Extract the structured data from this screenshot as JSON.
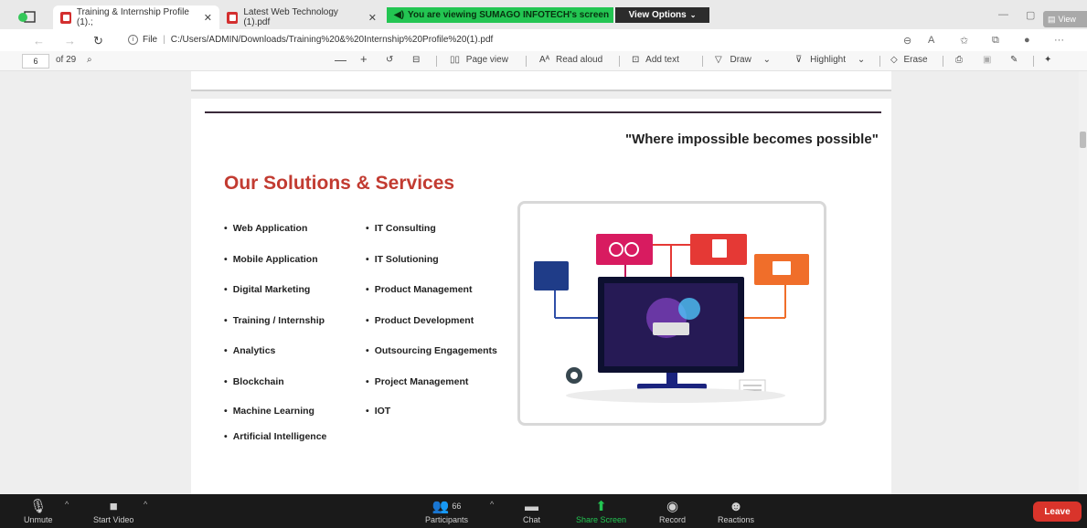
{
  "tabs": [
    {
      "title": "Training & Internship Profile (1).;",
      "active": true
    },
    {
      "title": "Latest Web Technology (1).pdf",
      "active": false
    }
  ],
  "share_banner": "You are viewing SUMAGO INFOTECH's screen",
  "view_options": "View Options",
  "view_button": "View",
  "address": {
    "prefix": "File",
    "url": "C:/Users/ADMIN/Downloads/Training%20&%20Internship%20Profile%20(1).pdf"
  },
  "pdf_toolbar": {
    "page_current": "6",
    "page_total": "of 29",
    "page_view": "Page view",
    "read_aloud": "Read aloud",
    "add_text": "Add text",
    "draw": "Draw",
    "highlight": "Highlight",
    "erase": "Erase"
  },
  "document": {
    "tagline": "\"Where impossible becomes possible\"",
    "heading": "Our Solutions & Services",
    "services_left": [
      "Web Application",
      "Mobile Application",
      "Digital Marketing",
      "Training / Internship",
      "Analytics",
      "Blockchain",
      "Machine Learning",
      "Artificial Intelligence"
    ],
    "services_right": [
      "IT Consulting",
      "IT Solutioning",
      "Product Management",
      "Product Development",
      "Outsourcing Engagements",
      "Project Management",
      "IOT"
    ]
  },
  "zoom_bar": {
    "unmute": "Unmute",
    "start_video": "Start Video",
    "participants": "Participants",
    "participant_count": "66",
    "chat": "Chat",
    "share_screen": "Share Screen",
    "record": "Record",
    "reactions": "Reactions",
    "leave": "Leave"
  },
  "colors": {
    "heading": "#c23b31",
    "share_green": "#23c552",
    "leave_red": "#d9342b"
  }
}
